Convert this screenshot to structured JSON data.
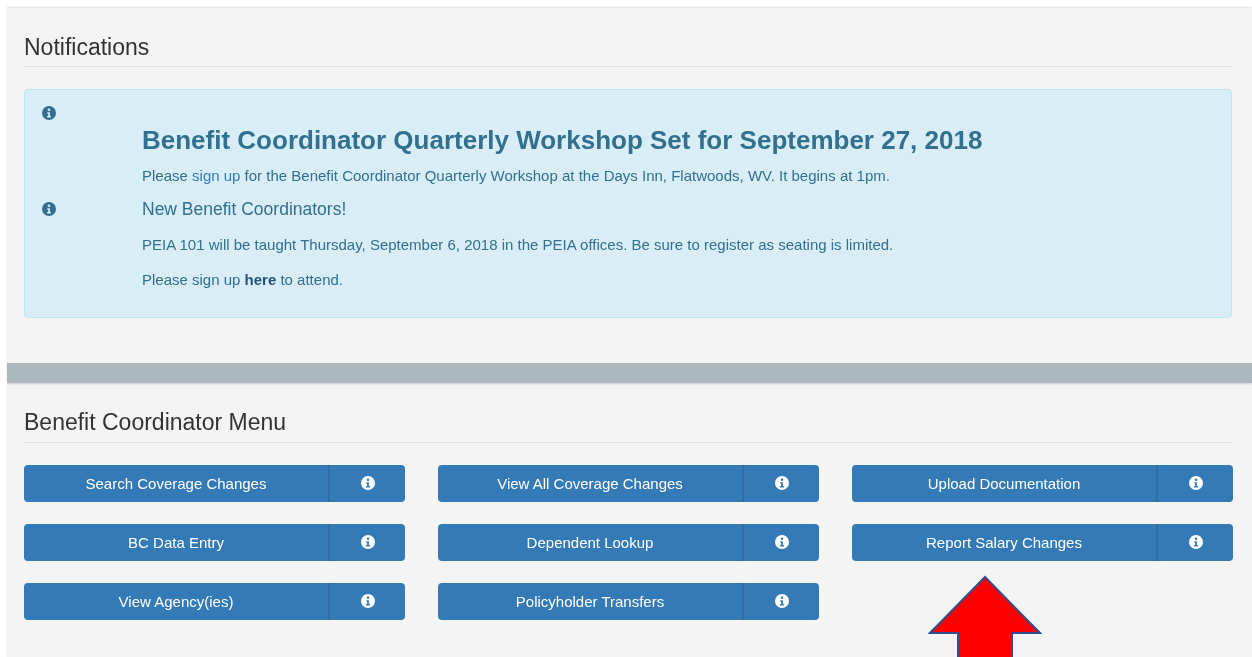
{
  "notifications": {
    "heading": "Notifications",
    "notices": [
      {
        "title": "Benefit Coordinator Quarterly Workshop Set for September 27, 2018",
        "kind": "large",
        "paragraphs": [
          [
            {
              "kind": "text",
              "text": "Please "
            },
            {
              "kind": "link",
              "text": "sign up",
              "bold": false
            },
            {
              "kind": "text",
              "text": " for the Benefit Coordinator Quarterly Workshop at the Days Inn, Flatwoods, WV. It begins at 1pm."
            }
          ]
        ]
      },
      {
        "title": "New Benefit Coordinators!",
        "kind": "small",
        "paragraphs": [
          [
            {
              "kind": "text",
              "text": "PEIA 101 will be taught Thursday, September 6, 2018 in the PEIA offices. Be sure to register as seating is limited."
            }
          ],
          [
            {
              "kind": "text",
              "text": "Please sign up "
            },
            {
              "kind": "link",
              "text": "here",
              "bold": true
            },
            {
              "kind": "text",
              "text": " to attend."
            }
          ]
        ]
      }
    ]
  },
  "menu": {
    "heading": "Benefit Coordinator Menu",
    "buttons": [
      {
        "label": "Search Coverage Changes"
      },
      {
        "label": "View All Coverage Changes"
      },
      {
        "label": "Upload Documentation"
      },
      {
        "label": "BC Data Entry"
      },
      {
        "label": "Dependent Lookup"
      },
      {
        "label": "Report Salary Changes"
      },
      {
        "label": "View Agency(ies)"
      },
      {
        "label": "Policyholder Transfers"
      }
    ]
  }
}
